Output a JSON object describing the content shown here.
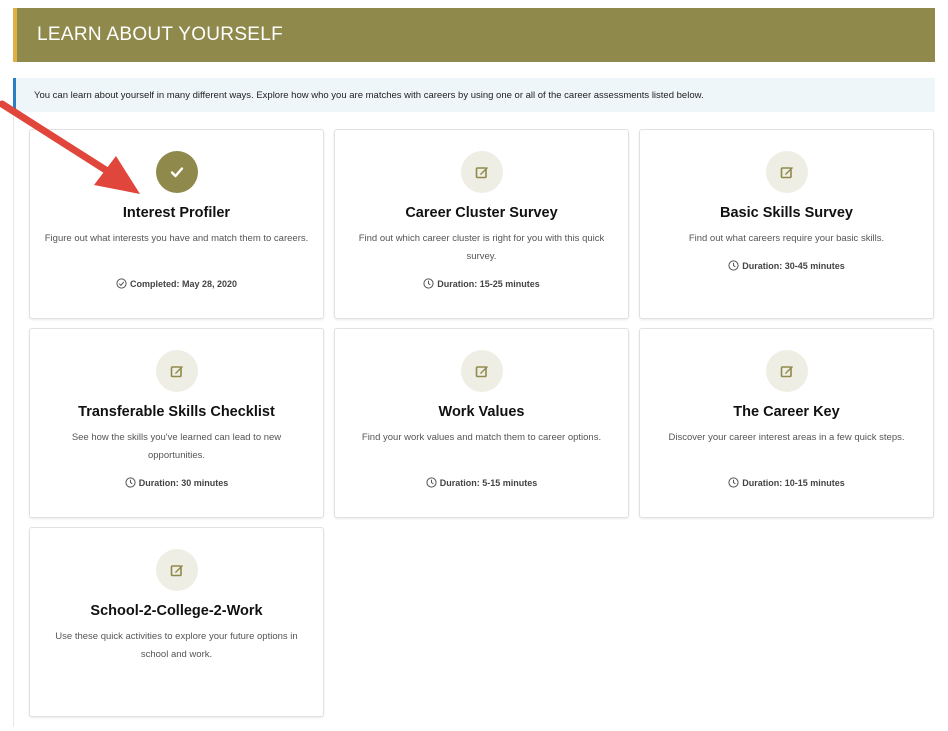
{
  "header": {
    "title": "LEARN ABOUT YOURSELF"
  },
  "intro": {
    "text": "You can learn about yourself in many different ways. Explore how who you are matches with careers by using one or all of the career assessments listed below."
  },
  "colors": {
    "brand": "#8f8a4c",
    "accent_left": "#e0b044",
    "info_accent": "#2b7fc4",
    "arrow": "#e0463b"
  },
  "cards": [
    {
      "title": "Interest Profiler",
      "description": "Figure out what interests you have and match them to careers.",
      "status": "Completed: May 28, 2020",
      "icon": "check-icon",
      "status_icon": "check-circle-icon"
    },
    {
      "title": "Career Cluster Survey",
      "description": "Find out which career cluster is right for you with this quick survey.",
      "status": "Duration: 15-25 minutes",
      "icon": "edit-icon",
      "status_icon": "clock-icon"
    },
    {
      "title": "Basic Skills Survey",
      "description": "Find out what careers require your basic skills.",
      "status": "Duration: 30-45 minutes",
      "icon": "edit-icon",
      "status_icon": "clock-icon"
    },
    {
      "title": "Transferable Skills Checklist",
      "description": "See how the skills you've learned can lead to new opportunities.",
      "status": "Duration: 30 minutes",
      "icon": "edit-icon",
      "status_icon": "clock-icon"
    },
    {
      "title": "Work Values",
      "description": "Find your work values and match them to career options.",
      "status": "Duration: 5-15 minutes",
      "icon": "edit-icon",
      "status_icon": "clock-icon"
    },
    {
      "title": "The Career Key",
      "description": "Discover your career interest areas in a few quick steps.",
      "status": "Duration: 10-15 minutes",
      "icon": "edit-icon",
      "status_icon": "clock-icon"
    },
    {
      "title": "School-2-College-2-Work",
      "description": "Use these quick activities to explore your future options in school and work.",
      "status": "",
      "icon": "edit-icon",
      "status_icon": ""
    }
  ]
}
